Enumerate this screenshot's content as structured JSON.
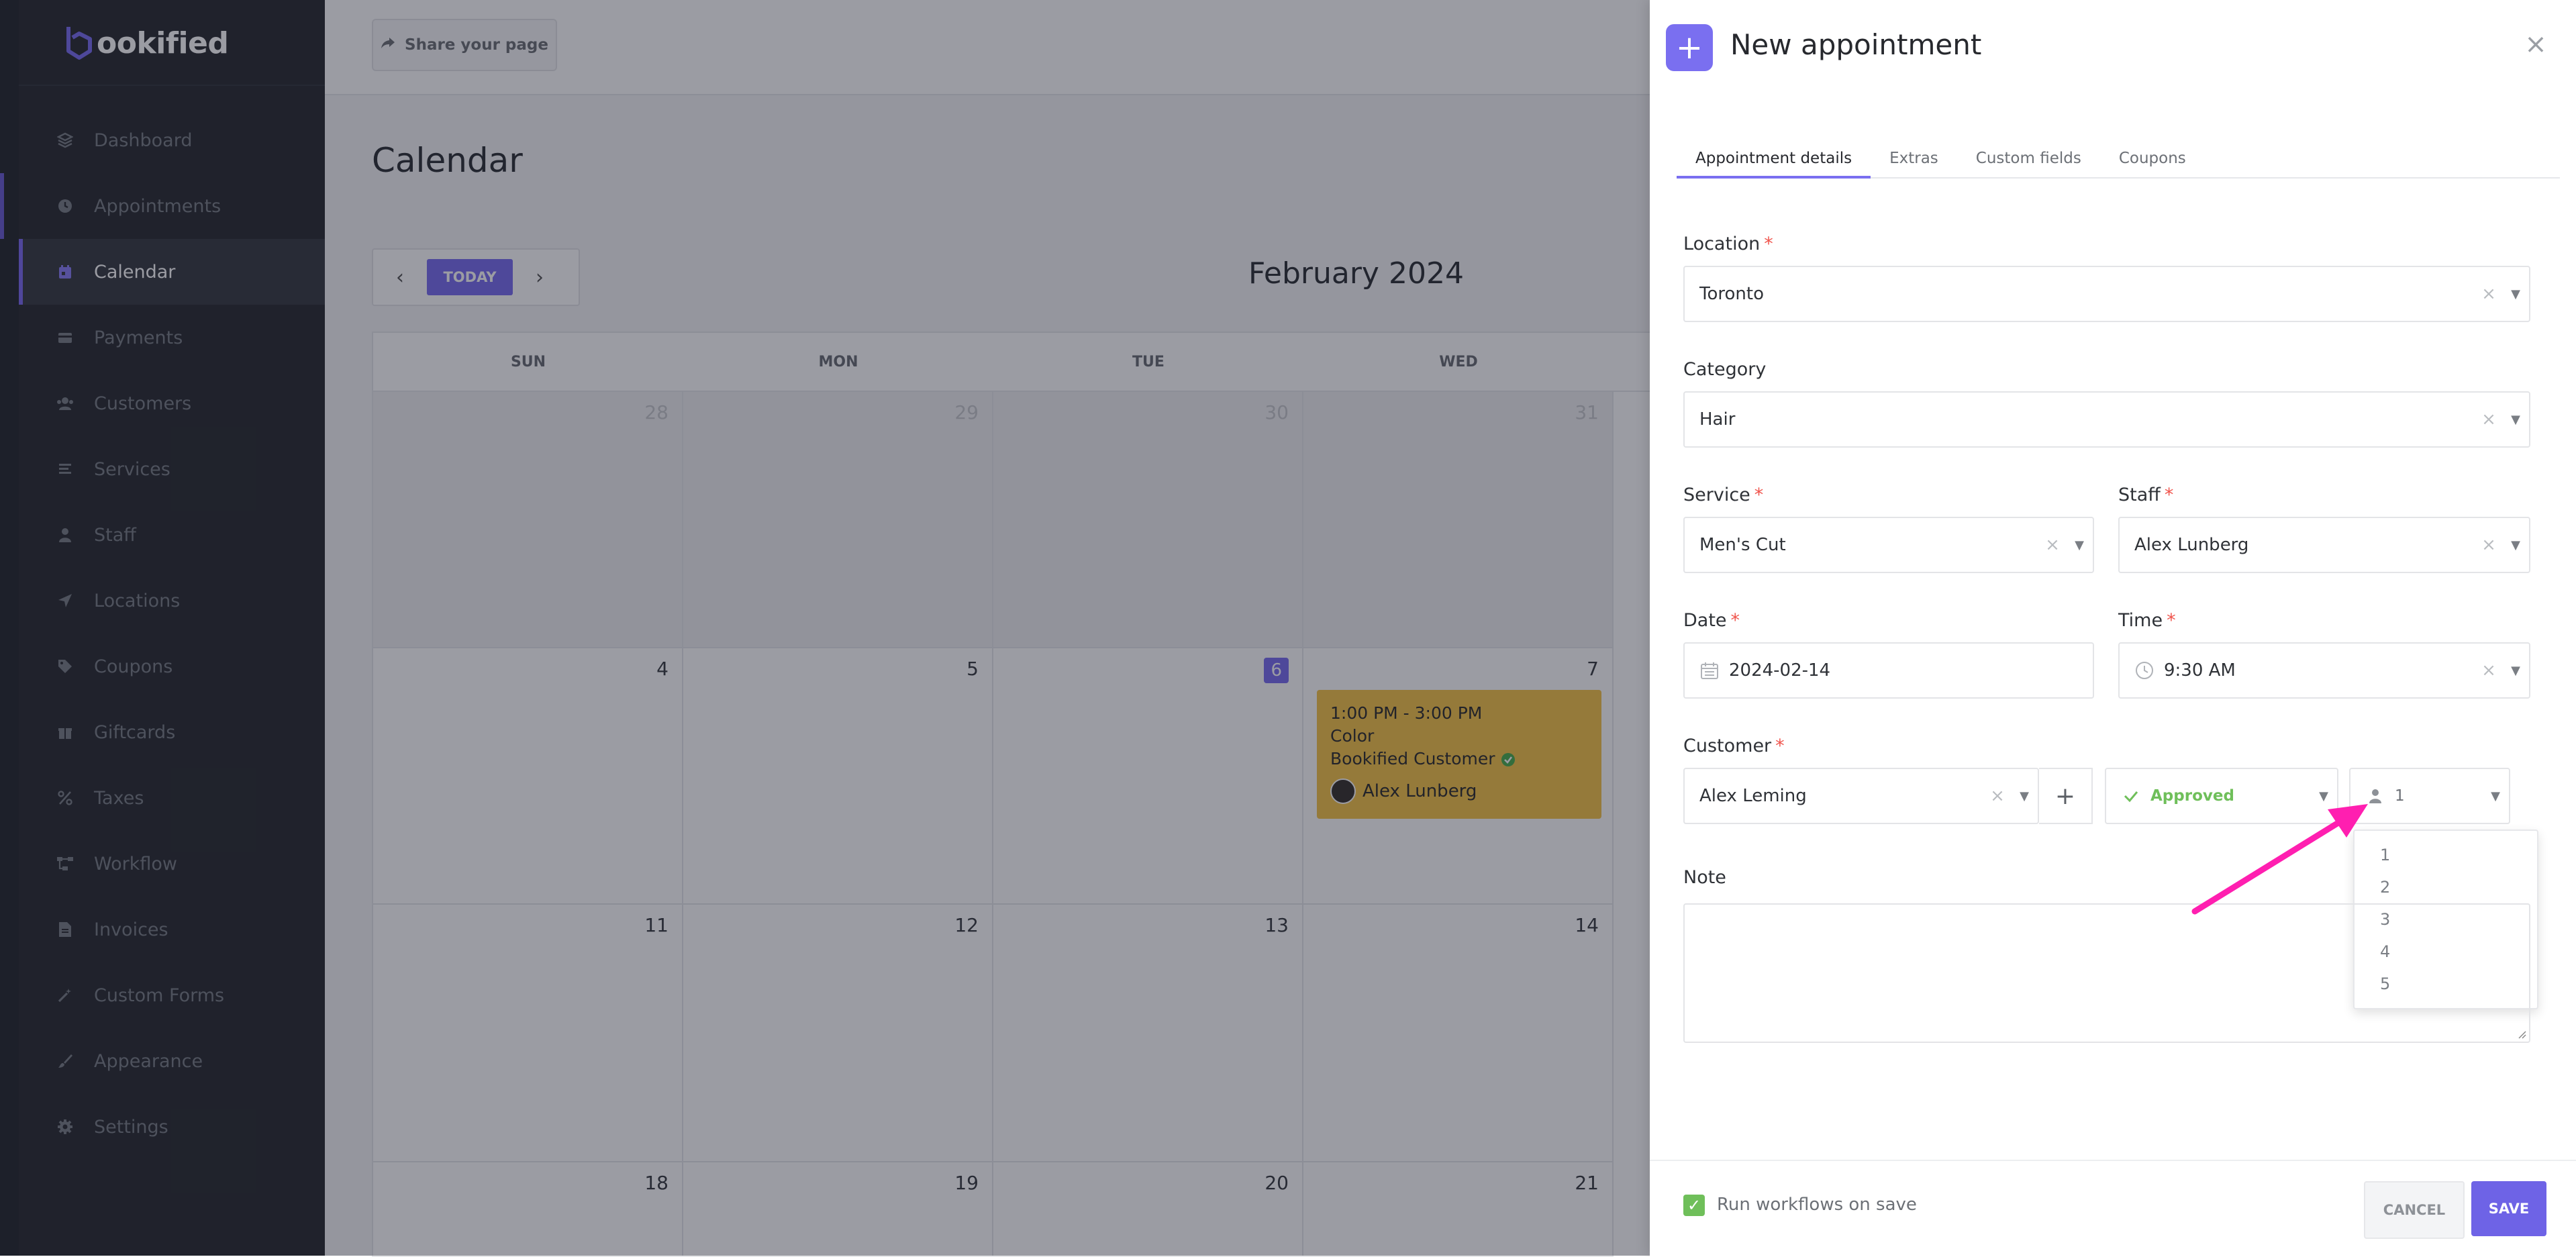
{
  "brand": {
    "name": "ookified",
    "accent": "#7a6ff0"
  },
  "sidebar": {
    "items": [
      {
        "label": "Dashboard",
        "icon": "dashboard-icon"
      },
      {
        "label": "Appointments",
        "icon": "clock-icon"
      },
      {
        "label": "Calendar",
        "icon": "calendar-icon",
        "active": true
      },
      {
        "label": "Payments",
        "icon": "payments-icon"
      },
      {
        "label": "Customers",
        "icon": "users-icon"
      },
      {
        "label": "Services",
        "icon": "list-icon"
      },
      {
        "label": "Staff",
        "icon": "user-icon"
      },
      {
        "label": "Locations",
        "icon": "location-arrow-icon"
      },
      {
        "label": "Coupons",
        "icon": "tag-icon"
      },
      {
        "label": "Giftcards",
        "icon": "gift-icon"
      },
      {
        "label": "Taxes",
        "icon": "percent-icon"
      },
      {
        "label": "Workflow",
        "icon": "workflow-icon"
      },
      {
        "label": "Invoices",
        "icon": "invoice-icon"
      },
      {
        "label": "Custom Forms",
        "icon": "wand-icon"
      },
      {
        "label": "Appearance",
        "icon": "brush-icon"
      },
      {
        "label": "Settings",
        "icon": "gear-icon"
      }
    ]
  },
  "topbar": {
    "share_label": "Share your page"
  },
  "calendar": {
    "title": "Calendar",
    "today_label": "TODAY",
    "month": "February 2024",
    "days_of_week": [
      "SUN",
      "MON",
      "TUE",
      "WED"
    ],
    "weeks": [
      [
        "28",
        "29",
        "30",
        "31"
      ],
      [
        "4",
        "5",
        "6",
        "7"
      ],
      [
        "11",
        "12",
        "13",
        "14"
      ],
      [
        "18",
        "19",
        "20",
        "21"
      ]
    ],
    "event": {
      "time": "1:00 PM - 3:00 PM",
      "service": "Color",
      "customer": "Bookified Customer",
      "staff": "Alex Lunberg"
    }
  },
  "modal": {
    "title": "New appointment",
    "tabs": [
      "Appointment details",
      "Extras",
      "Custom fields",
      "Coupons"
    ],
    "location": {
      "label": "Location",
      "value": "Toronto"
    },
    "category": {
      "label": "Category",
      "value": "Hair"
    },
    "service": {
      "label": "Service",
      "value": "Men's Cut"
    },
    "staff": {
      "label": "Staff",
      "value": "Alex Lunberg"
    },
    "date": {
      "label": "Date",
      "value": "2024-02-14"
    },
    "time": {
      "label": "Time",
      "value": "9:30 AM"
    },
    "customer": {
      "label": "Customer",
      "value": "Alex Leming"
    },
    "status": {
      "value": "Approved"
    },
    "people": {
      "value": "1",
      "options": [
        "1",
        "2",
        "3",
        "4",
        "5"
      ]
    },
    "note": {
      "label": "Note"
    },
    "footer": {
      "run_workflows_label": "Run workflows on save",
      "cancel_label": "CANCEL",
      "save_label": "SAVE"
    }
  },
  "annotation": {
    "color": "#ff1fb0"
  }
}
